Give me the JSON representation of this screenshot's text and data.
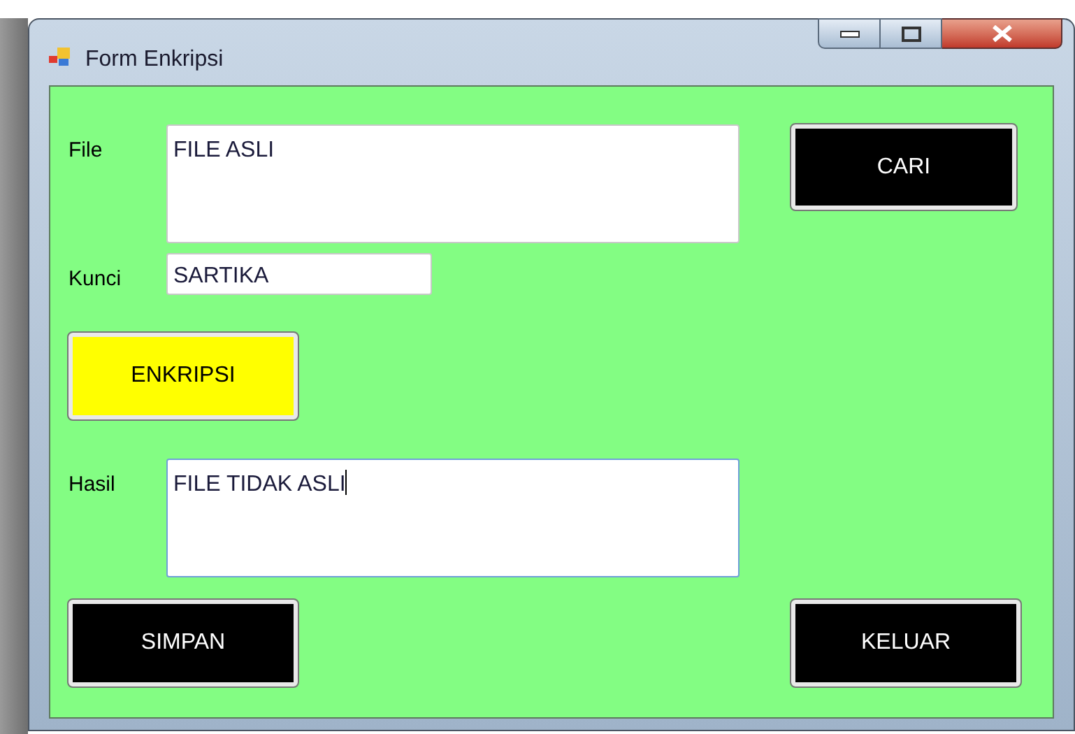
{
  "window": {
    "title": "Form Enkripsi"
  },
  "rows": [
    {
      "label": "File",
      "field": {
        "value": "FILE ASLI",
        "multiline": true,
        "focused": false
      },
      "button": {
        "label": "CARI",
        "color": "#000000"
      }
    },
    {
      "label": "Kunci",
      "field": {
        "value": "SARTIKA",
        "multiline": false,
        "focused": false
      }
    },
    {
      "button": {
        "label": "ENKRIPSI",
        "color": "#ffff00"
      }
    },
    {
      "label": "Hasil",
      "field": {
        "value": "FILE TIDAK ASLI",
        "multiline": true,
        "focused": true
      }
    },
    {
      "button": {
        "label": "SIMPAN",
        "color": "#000000"
      },
      "button_right": {
        "label": "KELUAR",
        "color": "#000000"
      }
    }
  ]
}
